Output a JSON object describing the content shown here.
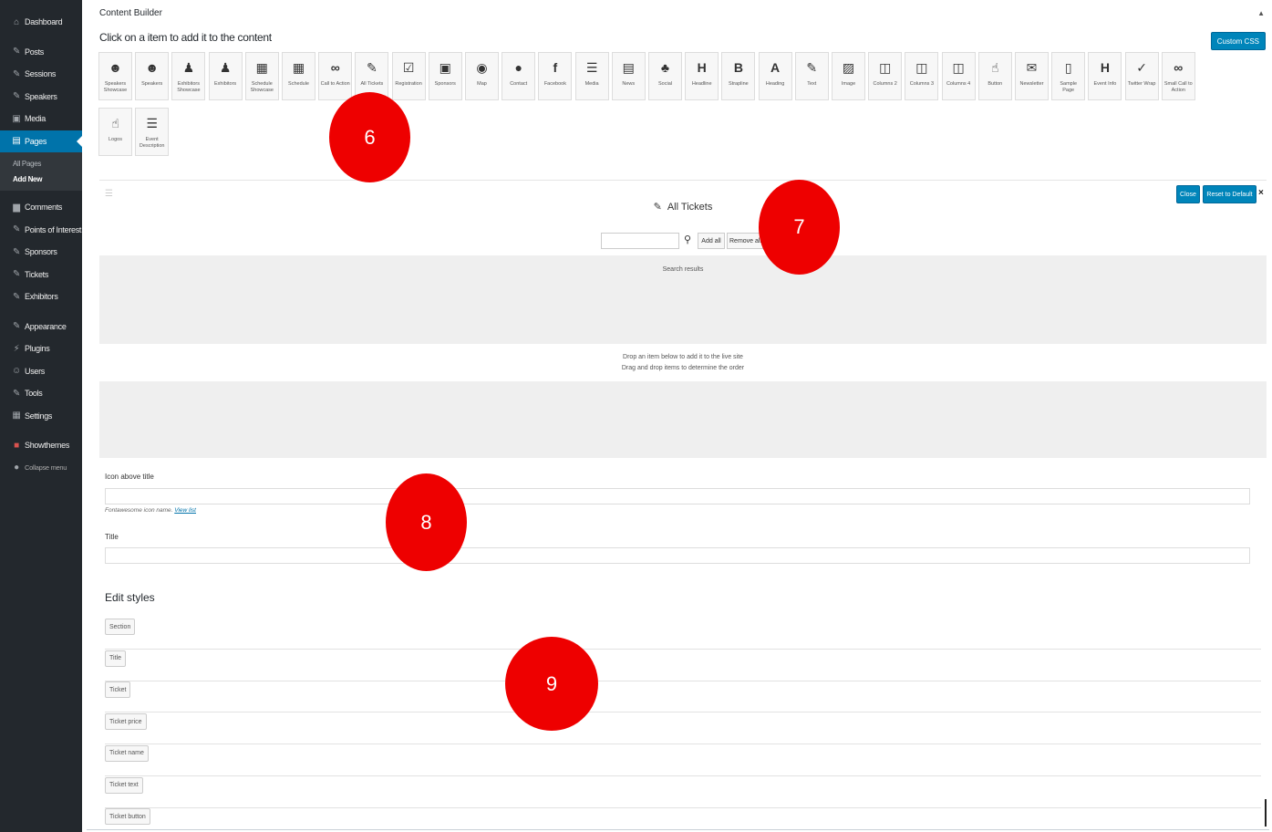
{
  "sidebar": {
    "items": [
      {
        "label": "Dashboard",
        "icon": "dashboard-icon",
        "glyph": "⌂"
      },
      {
        "label": "Posts",
        "icon": "pin-icon",
        "glyph": "✎"
      },
      {
        "label": "Sessions",
        "icon": "pin-icon",
        "glyph": "✎"
      },
      {
        "label": "Speakers",
        "icon": "pin-icon",
        "glyph": "✎"
      },
      {
        "label": "Media",
        "icon": "media-icon",
        "glyph": "▣"
      },
      {
        "label": "Pages",
        "icon": "page-icon",
        "glyph": "▤"
      },
      {
        "label": "Comments",
        "icon": "comment-icon",
        "glyph": "▆"
      },
      {
        "label": "Points of Interest",
        "icon": "pin-icon",
        "glyph": "✎"
      },
      {
        "label": "Sponsors",
        "icon": "pin-icon",
        "glyph": "✎"
      },
      {
        "label": "Tickets",
        "icon": "pin-icon",
        "glyph": "✎"
      },
      {
        "label": "Exhibitors",
        "icon": "pin-icon",
        "glyph": "✎"
      },
      {
        "label": "Appearance",
        "icon": "brush-icon",
        "glyph": "✎"
      },
      {
        "label": "Plugins",
        "icon": "plugin-icon",
        "glyph": "⚡"
      },
      {
        "label": "Users",
        "icon": "user-icon",
        "glyph": "☺"
      },
      {
        "label": "Tools",
        "icon": "wrench-icon",
        "glyph": "✎"
      },
      {
        "label": "Settings",
        "icon": "settings-icon",
        "glyph": "▦"
      },
      {
        "label": "Showthemes",
        "icon": "showthemes-icon",
        "glyph": "■"
      },
      {
        "label": "Collapse menu",
        "icon": "collapse-icon",
        "glyph": "●"
      }
    ],
    "pages_sub": [
      "All Pages",
      "Add New"
    ]
  },
  "content_builder": {
    "header": "Content Builder",
    "instruction": "Click on a item to add it to the content",
    "custom_css_label": "Custom CSS",
    "tiles": [
      {
        "label": "Speakers Showcase",
        "glyph": "☻",
        "icon": "users-icon"
      },
      {
        "label": "Speakers",
        "glyph": "☻",
        "icon": "users-icon"
      },
      {
        "label": "Exhibitors Showcase",
        "glyph": "♟",
        "icon": "person-icon"
      },
      {
        "label": "Exhibitors",
        "glyph": "♟",
        "icon": "person-icon"
      },
      {
        "label": "Schedule Showcase",
        "glyph": "▦",
        "icon": "schedule-icon"
      },
      {
        "label": "Schedule",
        "glyph": "▦",
        "icon": "schedule-icon"
      },
      {
        "label": "Call to Action",
        "glyph": "∞",
        "icon": "infinity-icon"
      },
      {
        "label": "All Tickets",
        "glyph": "✎",
        "icon": "ticket-icon"
      },
      {
        "label": "Registration",
        "glyph": "☑",
        "icon": "checkbox-icon"
      },
      {
        "label": "Sponsors",
        "glyph": "▣",
        "icon": "sponsors-icon"
      },
      {
        "label": "Map",
        "glyph": "◉",
        "icon": "map-icon"
      },
      {
        "label": "Contact",
        "glyph": "●",
        "icon": "contact-icon"
      },
      {
        "label": "Facebook",
        "glyph": "f",
        "icon": "facebook-icon"
      },
      {
        "label": "Media",
        "glyph": "☰",
        "icon": "media-icon"
      },
      {
        "label": "News",
        "glyph": "▤",
        "icon": "news-icon"
      },
      {
        "label": "Social",
        "glyph": "♣",
        "icon": "social-icon"
      },
      {
        "label": "Headline",
        "glyph": "H",
        "icon": "headline-icon"
      },
      {
        "label": "Strapline",
        "glyph": "B",
        "icon": "strapline-icon"
      },
      {
        "label": "Heading",
        "glyph": "A",
        "icon": "heading-icon"
      },
      {
        "label": "Text",
        "glyph": "✎",
        "icon": "pencil-icon"
      },
      {
        "label": "Image",
        "glyph": "▨",
        "icon": "image-icon"
      },
      {
        "label": "Columns 2",
        "glyph": "◫",
        "icon": "columns-icon"
      },
      {
        "label": "Columns 3",
        "glyph": "◫",
        "icon": "columns-icon"
      },
      {
        "label": "Columns 4",
        "glyph": "◫",
        "icon": "columns-icon"
      },
      {
        "label": "Button",
        "glyph": "☝",
        "icon": "pointer-icon"
      },
      {
        "label": "Newsletter",
        "glyph": "✉",
        "icon": "envelope-icon"
      },
      {
        "label": "Sample Page",
        "glyph": "▯",
        "icon": "file-icon"
      },
      {
        "label": "Event Info",
        "glyph": "H",
        "icon": "event-info-icon"
      },
      {
        "label": "Twitter Wrap",
        "glyph": "✓",
        "icon": "twitter-icon"
      },
      {
        "label": "Small Call to Action",
        "glyph": "∞",
        "icon": "infinity-icon"
      },
      {
        "label": "Logos",
        "glyph": "☝",
        "icon": "pointer-icon"
      },
      {
        "label": "Event Description",
        "glyph": "☰",
        "icon": "list-icon"
      }
    ]
  },
  "block": {
    "title": "All Tickets",
    "close_label": "Close",
    "reset_label": "Reset to Default",
    "x_label": "×",
    "add_all_label": "Add all",
    "remove_all_label": "Remove all",
    "search_results_label": "Search results",
    "drop_hint_1": "Drop an item below to add it to the live site",
    "drop_hint_2": "Drag and drop items to determine the order",
    "icon_field_label": "Icon above title",
    "icon_field_hint": "Fontawesome icon name.",
    "icon_field_hint_link": "View list",
    "title_field_label": "Title",
    "edit_styles_heading": "Edit styles",
    "style_buttons": [
      "Section",
      "Title",
      "Ticket",
      "Ticket price",
      "Ticket name",
      "Ticket text",
      "Ticket button"
    ]
  },
  "markers": [
    "6",
    "7",
    "8",
    "9"
  ],
  "colors": {
    "sidebar": "#23282d",
    "accent": "#0073aa",
    "button": "#0085ba",
    "marker": "#ee0000"
  }
}
